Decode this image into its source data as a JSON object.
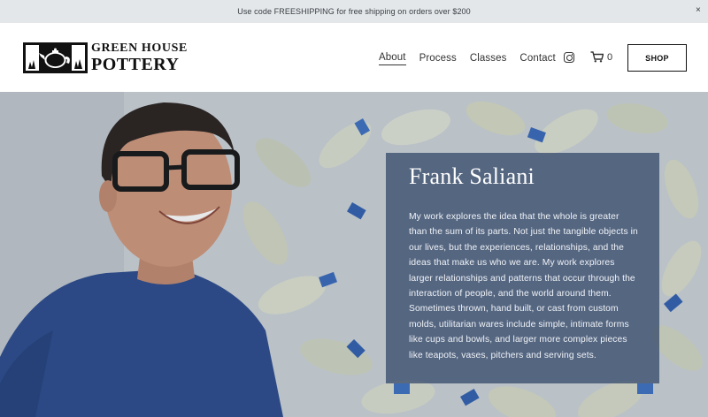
{
  "announcement": {
    "text": "Use code FREESHIPPING for free shipping on orders over $200",
    "close_glyph": "×"
  },
  "header": {
    "logo_line1": "GREEN HOUSE",
    "logo_line2": "POTTERY",
    "nav": [
      {
        "label": "About",
        "active": true
      },
      {
        "label": "Process"
      },
      {
        "label": "Classes"
      },
      {
        "label": "Contact"
      }
    ],
    "social_icon": "instagram-icon",
    "cart_icon": "cart-icon",
    "cart_count": "0",
    "shop_label": "SHOP"
  },
  "hero": {
    "title": "Frank Saliani",
    "body": "My work explores the idea that the whole is greater than the sum of its parts. Not just the tangible objects in our lives, but the experiences, relationships, and the ideas that make us who we are. My work explores larger relationships and patterns that occur through the interaction of people, and the world around them. Sometimes thrown, hand built, or cast from custom molds, utilitarian wares include simple, intimate forms like cups and bowls, and larger more complex pieces like teapots, vases, pitchers and serving sets."
  },
  "colors": {
    "announcement_bg": "#e3e7ea",
    "card_bg": "#2e4266",
    "shirt": "#2f4f8f",
    "ceramic_blue": "#2d5fb0"
  }
}
